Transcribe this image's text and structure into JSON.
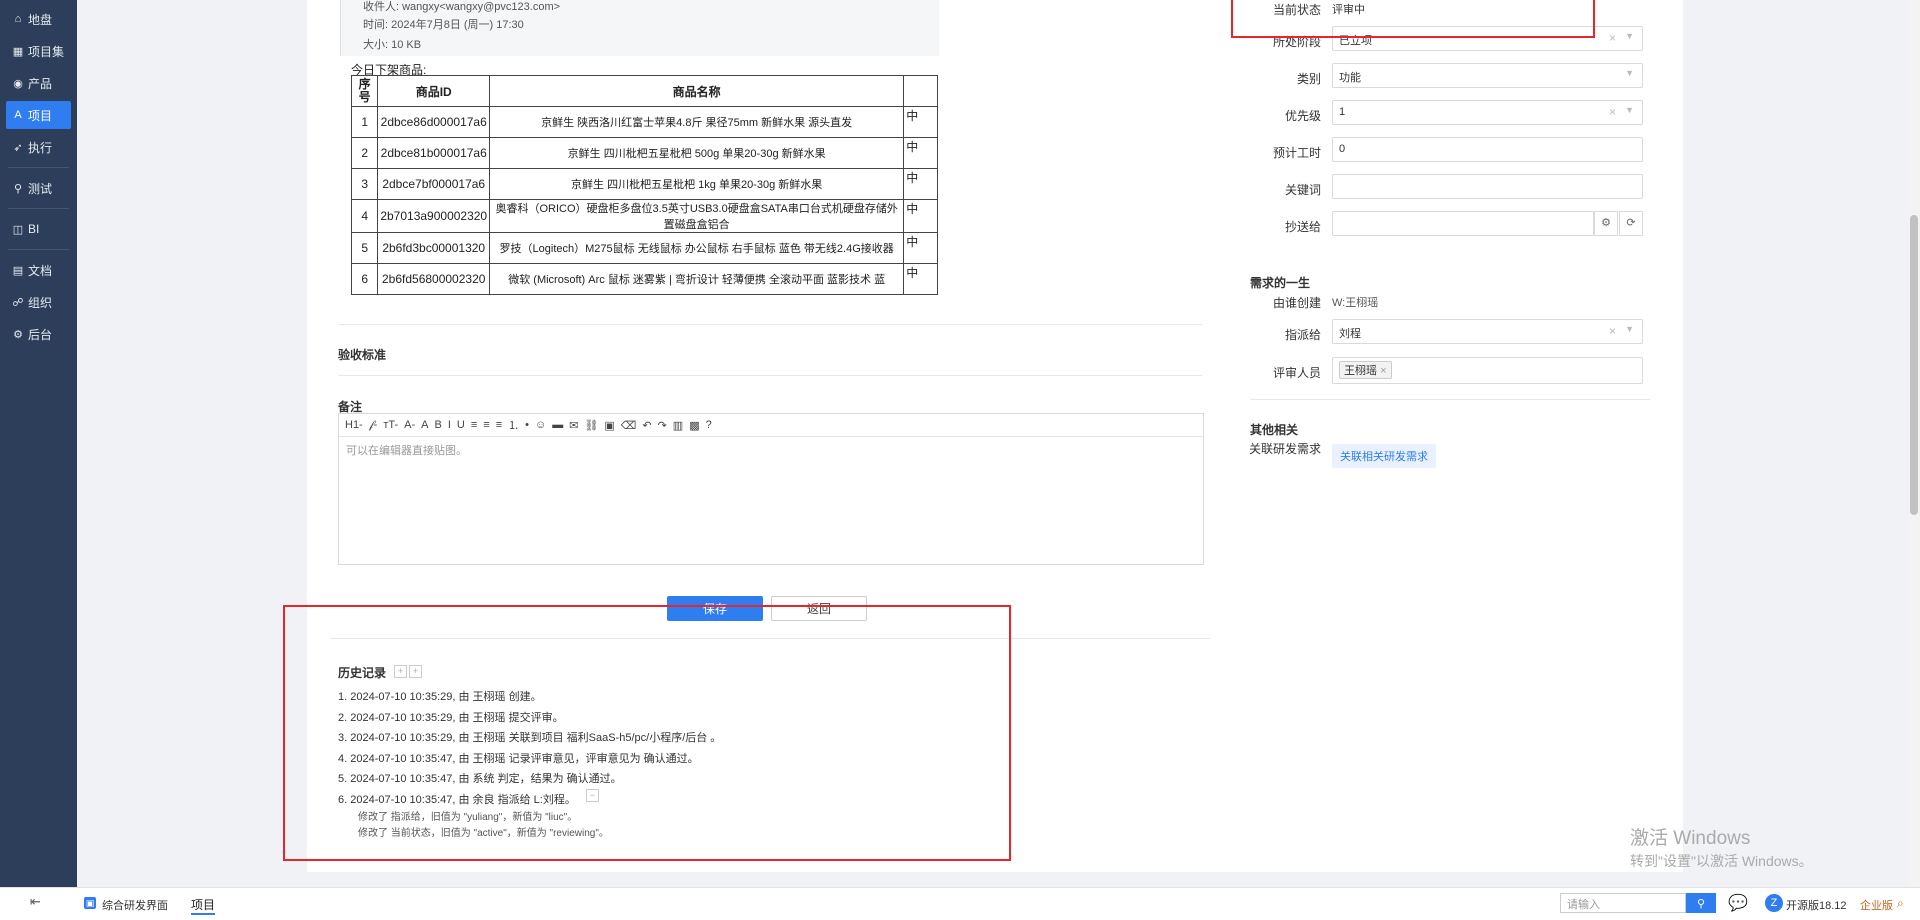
{
  "sidebar": {
    "items": [
      {
        "label": "地盘",
        "icon": "home-icon",
        "glyph": "⌂"
      },
      {
        "label": "项目集",
        "icon": "grid-icon",
        "glyph": "▦"
      },
      {
        "label": "产品",
        "icon": "pin-icon",
        "glyph": "◉"
      },
      {
        "label": "项目",
        "icon": "project-icon",
        "glyph": "A"
      },
      {
        "label": "执行",
        "icon": "rocket-icon",
        "glyph": "➶"
      },
      {
        "label": "测试",
        "icon": "test-icon",
        "glyph": "⚲"
      },
      {
        "label": "BI",
        "icon": "chart-icon",
        "glyph": "◫"
      },
      {
        "label": "文档",
        "icon": "doc-icon",
        "glyph": "▤"
      },
      {
        "label": "组织",
        "icon": "org-icon",
        "glyph": "☍"
      },
      {
        "label": "后台",
        "icon": "admin-icon",
        "glyph": "⚙"
      }
    ]
  },
  "email": {
    "recipient": "收件人: wangxy<wangxy@pvc123.com>",
    "time": "时间: 2024年7月8日 (周一) 17:30",
    "size": "大小: 10 KB"
  },
  "goods_list_title": "今日下架商品:",
  "goods_table": {
    "headers": [
      "序号",
      "商品ID",
      "商品名称"
    ],
    "rows": [
      {
        "no": "1",
        "id": "2dbce86d000017a6",
        "name": "京鲜生 陕西洛川红富士苹果4.8斤 果径75mm 新鲜水果 源头直发",
        "extra": "中"
      },
      {
        "no": "2",
        "id": "2dbce81b000017a6",
        "name": "京鲜生 四川枇杷五星枇杷 500g 单果20-30g 新鲜水果",
        "extra": "中"
      },
      {
        "no": "3",
        "id": "2dbce7bf000017a6",
        "name": "京鲜生 四川枇杷五星枇杷 1kg 单果20-30g 新鲜水果",
        "extra": "中"
      },
      {
        "no": "4",
        "id": "2b7013a900002320",
        "name": "奥睿科（ORICO）硬盘柜多盘位3.5英寸USB3.0硬盘盒SATA串口台式机硬盘存储外置磁盘盒铝合",
        "extra": "中"
      },
      {
        "no": "5",
        "id": "2b6fd3bc00001320",
        "name": "罗技（Logitech）M275鼠标 无线鼠标 办公鼠标 右手鼠标 蓝色 带无线2.4G接收器",
        "extra": "中"
      },
      {
        "no": "6",
        "id": "2b6fd56800002320",
        "name": "微软 (Microsoft) Arc 鼠标 迷雾紫 | 弯折设计 轻薄便携 全滚动平面 蓝影技术 蓝",
        "extra": "中"
      }
    ]
  },
  "acceptance_label": "验收标准",
  "remark_label": "备注",
  "editor": {
    "placeholder": "可以在编辑器直接贴图。",
    "toolbar": [
      "H1-",
      "𝒻-",
      "тT-",
      "A-",
      "A",
      "B",
      "I",
      "U",
      "≡",
      "≡",
      "≡",
      "⒈",
      "•",
      "☺",
      "▬",
      "✉",
      "⛓",
      "▣",
      "⌫",
      "↶",
      "↷",
      "▥",
      "▩",
      "?"
    ]
  },
  "buttons": {
    "save": "保存",
    "back": "返回"
  },
  "history": {
    "title": "历史记录",
    "entries": [
      "1. 2024-07-10 10:35:29, 由 王栩瑶 创建。",
      "2. 2024-07-10 10:35:29, 由 王栩瑶 提交评审。",
      "3. 2024-07-10 10:35:29, 由 王栩瑶 关联到项目 福利SaaS-h5/pc/小程序/后台 。",
      "4. 2024-07-10 10:35:47, 由 王栩瑶 记录评审意见，评审意见为 确认通过。",
      "5. 2024-07-10 10:35:47, 由 系统 判定，结果为 确认通过。",
      "6. 2024-07-10 10:35:47, 由 余良 指派给 L:刘程。"
    ],
    "details": [
      "修改了 指派给，旧值为 \"yuliang\"，新值为 \"liuc\"。",
      "修改了 当前状态，旧值为 \"active\"，新值为 \"reviewing\"。"
    ]
  },
  "side": {
    "current_status_label": "当前状态",
    "current_status_value": "评审中",
    "stage_label": "所处阶段",
    "stage_value": "已立项",
    "category_label": "类别",
    "category_value": "功能",
    "priority_label": "优先级",
    "priority_value": "1",
    "estimate_label": "预计工时",
    "estimate_value": "0",
    "keywords_label": "关键词",
    "keywords_value": "",
    "cc_label": "抄送给",
    "cc_value": "",
    "lifecycle_title": "需求的一生",
    "created_by_label": "由谁创建",
    "created_by_value": "W:王栩瑶",
    "assigned_label": "指派给",
    "assigned_value": "刘程",
    "reviewers_label": "评审人员",
    "reviewer_tag": "王栩瑶",
    "other_title": "其他相关",
    "related_label": "关联研发需求",
    "related_button": "关联相关研发需求"
  },
  "bottombar": {
    "app_label": "综合研发界面",
    "tab_label": "项目",
    "search_placeholder": "请输入",
    "version": "开源版18.12",
    "edition": "企业版"
  },
  "watermark": {
    "line1": "激活 Windows",
    "line2": "转到\"设置\"以激活 Windows。"
  },
  "colors": {
    "accent": "#2f7ef1",
    "sidebar": "#2c3e5a",
    "highlight": "#e5262a"
  }
}
